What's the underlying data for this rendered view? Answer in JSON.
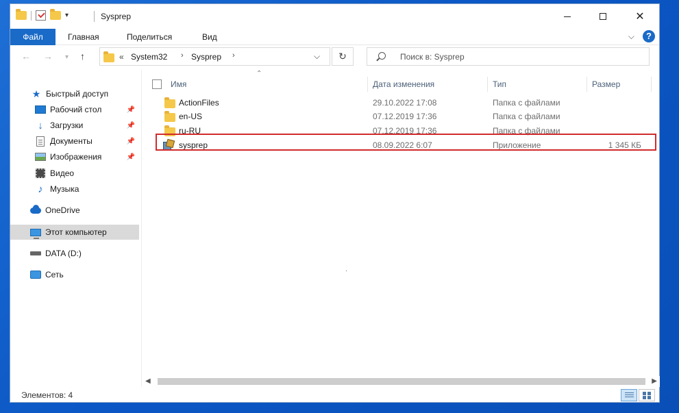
{
  "window": {
    "title": "Sysprep"
  },
  "window_controls": {
    "minimize": "—",
    "maximize": "☐",
    "close": "✕"
  },
  "ribbon": {
    "tabs": [
      {
        "label": "Файл"
      },
      {
        "label": "Главная"
      },
      {
        "label": "Поделиться"
      },
      {
        "label": "Вид"
      }
    ],
    "help": "?"
  },
  "address": {
    "overflow": "«",
    "crumbs": [
      "System32",
      "Sysprep"
    ]
  },
  "search": {
    "placeholder": "Поиск в: Sysprep"
  },
  "sidebar": {
    "items": [
      {
        "label": "Быстрый доступ",
        "icon": "star-icon"
      },
      {
        "label": "Рабочий стол",
        "icon": "desktop-icon",
        "pinned": true
      },
      {
        "label": "Загрузки",
        "icon": "download-icon",
        "pinned": true
      },
      {
        "label": "Документы",
        "icon": "documents-icon",
        "pinned": true
      },
      {
        "label": "Изображения",
        "icon": "pictures-icon",
        "pinned": true
      },
      {
        "label": "Видео",
        "icon": "video-icon"
      },
      {
        "label": "Музыка",
        "icon": "music-icon"
      },
      {
        "label": "OneDrive",
        "icon": "cloud-icon"
      },
      {
        "label": "Этот компьютер",
        "icon": "computer-icon",
        "selected": true
      },
      {
        "label": "DATA (D:)",
        "icon": "drive-icon"
      },
      {
        "label": "Сеть",
        "icon": "network-icon"
      }
    ]
  },
  "columns": {
    "name": "Имя",
    "date": "Дата изменения",
    "type": "Тип",
    "size": "Размер"
  },
  "files": [
    {
      "name": "ActionFiles",
      "date": "29.10.2022 17:08",
      "type": "Папка с файлами",
      "size": "",
      "kind": "folder"
    },
    {
      "name": "en-US",
      "date": "07.12.2019 17:36",
      "type": "Папка с файлами",
      "size": "",
      "kind": "folder"
    },
    {
      "name": "ru-RU",
      "date": "07.12.2019 17:36",
      "type": "Папка с файлами",
      "size": "",
      "kind": "folder"
    },
    {
      "name": "sysprep",
      "date": "08.09.2022 6:07",
      "type": "Приложение",
      "size": "1 345 КБ",
      "kind": "app",
      "highlighted": true
    }
  ],
  "status": {
    "items_text": "Элементов: 4"
  },
  "colors": {
    "accent": "#1a6ac7",
    "highlight_border": "#d12a2a",
    "folder": "#f5c84a"
  }
}
